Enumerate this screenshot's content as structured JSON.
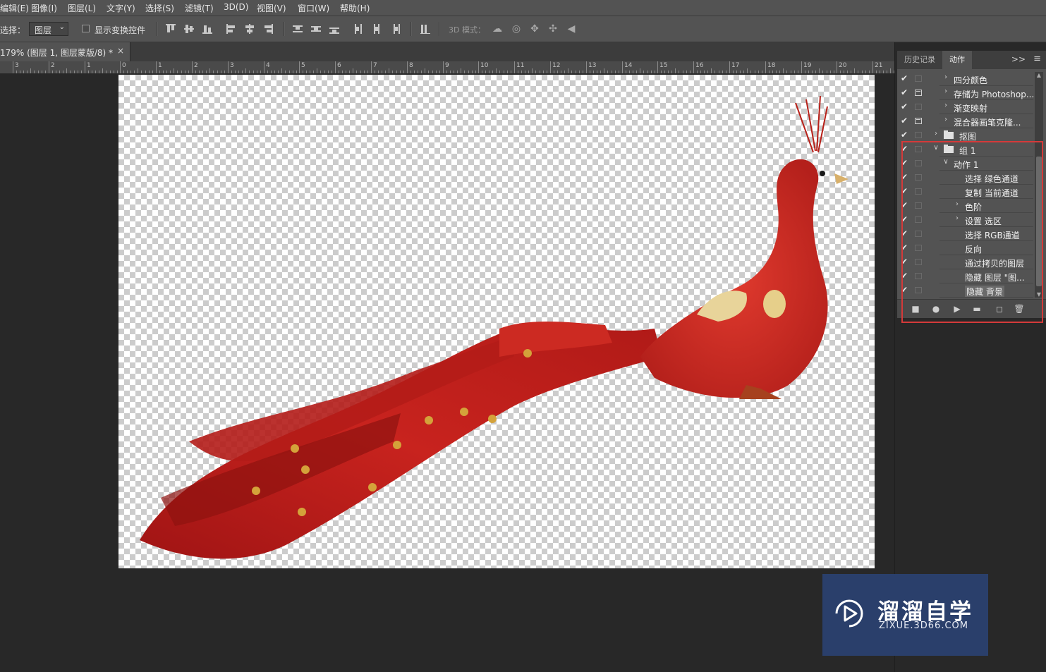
{
  "menubar": {
    "items": [
      "编辑(E)",
      "图像(I)",
      "图层(L)",
      "文字(Y)",
      "选择(S)",
      "滤镜(T)",
      "3D(D)",
      "视图(V)",
      "窗口(W)",
      "帮助(H)"
    ]
  },
  "options": {
    "select_label": "选择：",
    "layer_select_value": "图层",
    "show_transform_label": "显示变换控件",
    "mode_3d_label": "3D 模式："
  },
  "document": {
    "tab_title": "179% (图层 1, 图层蒙版/8) *",
    "tab_close": "×"
  },
  "ruler": {
    "labels": [
      "3",
      "2",
      "1",
      "0",
      "1",
      "2",
      "3",
      "4",
      "5",
      "6",
      "7",
      "8",
      "9",
      "10",
      "11",
      "12",
      "13",
      "14",
      "15",
      "16",
      "17",
      "18",
      "19",
      "20",
      "21"
    ]
  },
  "panel": {
    "tabs": [
      "历史记录",
      "动作"
    ],
    "active_tab": "动作",
    "collapse_icon": ">>",
    "menu_icon": "≡",
    "rows": [
      {
        "label": "四分颜色",
        "indent": 2,
        "expander": "right",
        "checked": true,
        "dialog": false
      },
      {
        "label": "存储为 Photoshop...",
        "indent": 2,
        "expander": "right",
        "checked": true,
        "dialog": true
      },
      {
        "label": "渐变映射",
        "indent": 2,
        "expander": "right",
        "checked": true,
        "dialog": false
      },
      {
        "label": "混合器画笔克隆...",
        "indent": 2,
        "expander": "right",
        "checked": true,
        "dialog": true
      },
      {
        "label": "抠图",
        "indent": 1,
        "expander": "right",
        "checked": true,
        "dialog": false,
        "folder": true
      },
      {
        "label": "组 1",
        "indent": 1,
        "expander": "down",
        "checked": true,
        "dialog": false,
        "folder": true
      },
      {
        "label": "动作 1",
        "indent": 2,
        "expander": "down",
        "checked": true,
        "dialog": false
      },
      {
        "label": "选择 绿色通道",
        "indent": 3,
        "expander": "none",
        "checked": true,
        "dialog": false
      },
      {
        "label": "复制 当前通道",
        "indent": 3,
        "expander": "none",
        "checked": true,
        "dialog": false
      },
      {
        "label": "色阶",
        "indent": 3,
        "expander": "right",
        "checked": true,
        "dialog": false
      },
      {
        "label": "设置 选区",
        "indent": 3,
        "expander": "right",
        "checked": true,
        "dialog": false
      },
      {
        "label": "选择 RGB通道",
        "indent": 3,
        "expander": "none",
        "checked": true,
        "dialog": false
      },
      {
        "label": "反向",
        "indent": 3,
        "expander": "none",
        "checked": true,
        "dialog": false
      },
      {
        "label": "通过拷贝的图层",
        "indent": 3,
        "expander": "none",
        "checked": true,
        "dialog": false
      },
      {
        "label": "隐藏 图层 \"图...",
        "indent": 3,
        "expander": "none",
        "checked": true,
        "dialog": false
      },
      {
        "label": "隐藏 背景",
        "indent": 3,
        "expander": "none",
        "checked": true,
        "dialog": false,
        "selected": true
      }
    ],
    "footer_buttons": [
      "stop-icon",
      "record-icon",
      "play-icon",
      "new-set-icon",
      "new-action-icon",
      "delete-icon"
    ]
  },
  "colors": {
    "accent_highlight": "#d43a3a",
    "peacock_red": "#c4201c",
    "watermark_bg": "#2a3f6b"
  },
  "watermark": {
    "title": "溜溜自学",
    "url": "ZIXUE.3D66.COM"
  }
}
